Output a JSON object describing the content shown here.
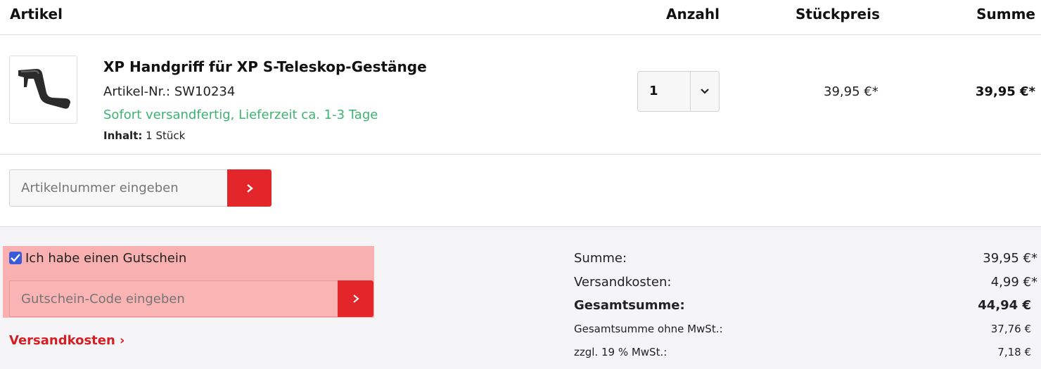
{
  "header": {
    "artikel": "Artikel",
    "anzahl": "Anzahl",
    "stueckpreis": "Stückpreis",
    "summe": "Summe"
  },
  "item": {
    "name": "XP Handgriff für XP S-Teleskop-Gestänge",
    "number": "Artikel-Nr.: SW10234",
    "shipping": "Sofort versandfertig, Lieferzeit ca. 1-3 Tage",
    "content_label": "Inhalt:",
    "content_value": "1 Stück",
    "quantity": "1",
    "unit_price": "39,95 €*",
    "total": "39,95 €*"
  },
  "add_product": {
    "placeholder": "Artikelnummer eingeben"
  },
  "coupon": {
    "label": "Ich habe einen Gutschein",
    "checked": true,
    "placeholder": "Gutschein-Code eingeben",
    "highlight_color": "#f9b0b0"
  },
  "shipping_link": "Versandkosten ›",
  "summary": {
    "rows": [
      {
        "label": "Summe:",
        "value": "39,95 €*"
      },
      {
        "label": "Versandkosten:",
        "value": "4,99 €*"
      },
      {
        "label": "Gesamtsumme:",
        "value": "44,94 €"
      },
      {
        "label": "Gesamtsumme ohne MwSt.:",
        "value": "37,76 €"
      },
      {
        "label": "zzgl. 19 % MwSt.:",
        "value": "7,18 €"
      }
    ]
  },
  "colors": {
    "accent": "#e2262a",
    "link": "#d51e23",
    "in_stock": "#3cb371"
  },
  "icons": {
    "quantity_dropdown": "chevron-down-icon",
    "submit": "chevron-right-icon",
    "checkbox": "check-icon"
  }
}
